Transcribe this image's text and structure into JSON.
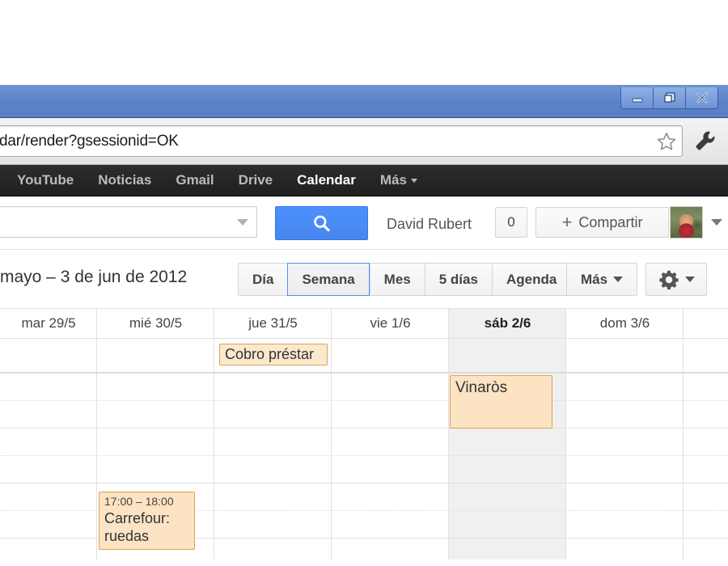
{
  "browser": {
    "window_controls": [
      {
        "name": "minimize",
        "icon": "minimize-icon"
      },
      {
        "name": "restore",
        "icon": "restore-icon"
      },
      {
        "name": "close",
        "icon": "close-icon"
      }
    ],
    "omnibox": {
      "value": "dar/render?gsessionid=OK",
      "placeholder": "Buscar o escribir una URL",
      "star_icon": "bookmark-star-icon",
      "wrench_icon": "wrench-menu-icon"
    }
  },
  "gbar": {
    "items": [
      {
        "label": "YouTube",
        "active": false
      },
      {
        "label": "Noticias",
        "active": false
      },
      {
        "label": "Gmail",
        "active": false
      },
      {
        "label": "Drive",
        "active": false
      },
      {
        "label": "Calendar",
        "active": true
      },
      {
        "label": "Más",
        "active": false,
        "caret": true
      }
    ]
  },
  "account_bar": {
    "search": {
      "value": "",
      "placeholder": ""
    },
    "search_button_icon": "search-magnifier-icon",
    "user_name": "David Rubert",
    "notification_count": "0",
    "share_label": "Compartir",
    "share_plus": "+",
    "avatar_name": "user-avatar-photo"
  },
  "calendar": {
    "date_range": "mayo – 3 de jun de 2012",
    "views": [
      {
        "label": "Día",
        "selected": false
      },
      {
        "label": "Semana",
        "selected": true
      },
      {
        "label": "Mes",
        "selected": false
      },
      {
        "label": "5 días",
        "selected": false
      },
      {
        "label": "Agenda",
        "selected": false
      }
    ],
    "more_label": "Más",
    "settings_icon": "gear-icon",
    "days": [
      {
        "label": "mar 29/5",
        "today": false
      },
      {
        "label": "mié 30/5",
        "today": false
      },
      {
        "label": "jue 31/5",
        "today": false
      },
      {
        "label": "vie 1/6",
        "today": false
      },
      {
        "label": "sáb 2/6",
        "today": true
      },
      {
        "label": "dom 3/6",
        "today": false
      }
    ],
    "allday_events": [
      {
        "title": "Cobro préstar",
        "day": "jue 31/5"
      }
    ],
    "timed_events": [
      {
        "title": "Vinaròs",
        "time": "",
        "day": "sáb 2/6"
      },
      {
        "title": "Carrefour: ruedas",
        "time": "17:00 – 18:00",
        "day": "mié 30/5"
      }
    ]
  },
  "colors": {
    "titlebar_blue": "#5b80c6",
    "google_blue": "#4d90fe",
    "gbar_dark": "#2d2d2d",
    "event_orange_bg": "#fce3c3",
    "event_orange_border": "#dba451",
    "today_highlight": "#f0f0f0"
  }
}
